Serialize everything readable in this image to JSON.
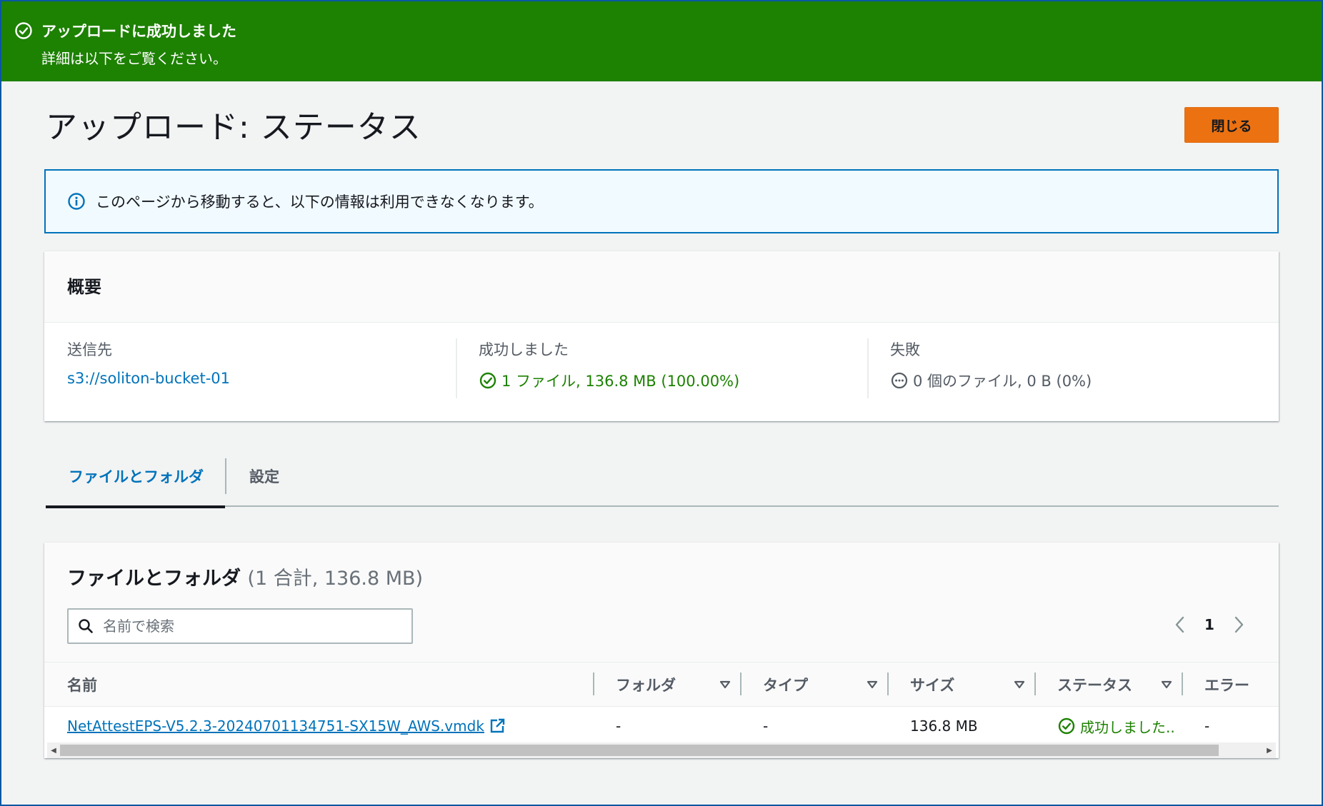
{
  "flash": {
    "title": "アップロードに成功しました",
    "detail": "詳細は以下をご覧ください。"
  },
  "page": {
    "title": "アップロード: ステータス",
    "close_button": "閉じる"
  },
  "info_alert": {
    "text": "このページから移動すると、以下の情報は利用できなくなります。"
  },
  "summary": {
    "heading": "概要",
    "destination": {
      "label": "送信先",
      "value": "s3://soliton-bucket-01"
    },
    "succeeded": {
      "label": "成功しました",
      "value": "1 ファイル, 136.8 MB (100.00%)"
    },
    "failed": {
      "label": "失敗",
      "value": "0 個のファイル, 0 B (0%)"
    }
  },
  "tabs": [
    {
      "label": "ファイルとフォルダ",
      "active": true
    },
    {
      "label": "設定",
      "active": false
    }
  ],
  "files": {
    "title": "ファイルとフォルダ",
    "count": "(1 合計, 136.8 MB)",
    "search_placeholder": "名前で検索",
    "page": "1",
    "columns": [
      "名前",
      "フォルダ",
      "タイプ",
      "サイズ",
      "ステータス",
      "エラー"
    ],
    "rows": [
      {
        "name": "NetAttestEPS-V5.2.3-20240701134751-SX15W_AWS.vmdk",
        "folder": "-",
        "type": "-",
        "size": "136.8 MB",
        "status": "成功しました..",
        "error": "-"
      }
    ]
  },
  "colors": {
    "success": "#1d8102",
    "link": "#0073bb",
    "primary_button": "#ec7211",
    "info_border": "#0073bb"
  },
  "icons": {
    "flash": "check-circle-icon",
    "info": "info-circle-icon",
    "succeeded": "check-circle-icon",
    "failed": "pending-circle-icon",
    "search": "search-icon",
    "external": "external-link-icon"
  }
}
